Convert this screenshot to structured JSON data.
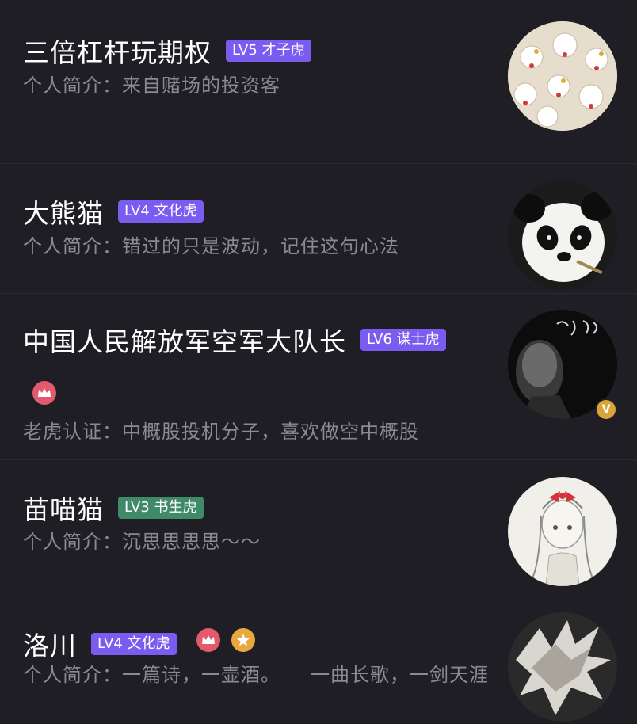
{
  "users": [
    {
      "name": "三倍杠杆玩期权",
      "level": "LV5 才子虎",
      "bio_label": "个人简介：",
      "bio": "来自赌场的投资客"
    },
    {
      "name": "大熊猫",
      "level": "LV4 文化虎",
      "bio_label": "个人简介：",
      "bio": "错过的只是波动，记住这句心法"
    },
    {
      "name": "中国人民解放军空军大队长",
      "level": "LV6 谋士虎",
      "bio_label": "老虎认证：",
      "bio": "中概股投机分子，喜欢做空中概股",
      "verified": "V"
    },
    {
      "name": "苗喵猫",
      "level": "LV3 书生虎",
      "bio_label": "个人简介：",
      "bio": "沉思思思思～～"
    },
    {
      "name": "洛川",
      "level": "LV4 文化虎",
      "bio_label": "个人简介：",
      "bio": "一篇诗，一壶酒。　　一曲长歌，一剑天涯"
    }
  ],
  "colors": {
    "background": "#1e1e24",
    "badge_purple": "#7b5cf0",
    "badge_green": "#3f8a68",
    "crown": "#e25a6c",
    "star": "#e8a83e"
  },
  "icons": [
    "crown-icon",
    "star-icon",
    "verified-icon"
  ]
}
